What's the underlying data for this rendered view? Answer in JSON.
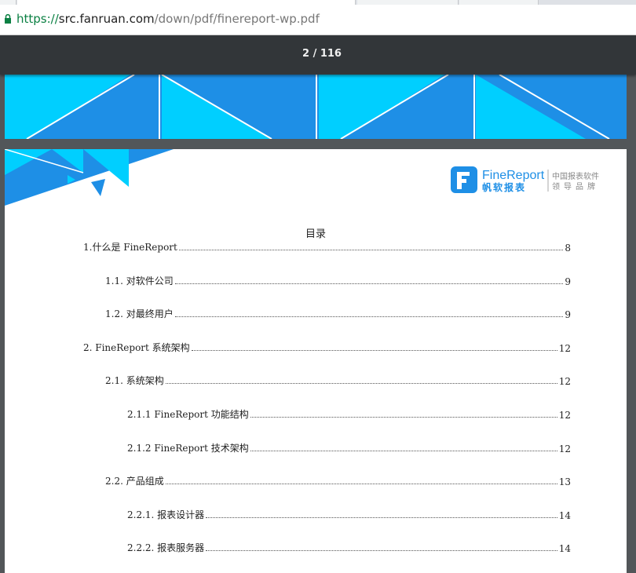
{
  "browser": {
    "url_scheme": "https://",
    "url_host": "src.fanruan.com",
    "url_path": "/down/pdf/finereport-wp.pdf"
  },
  "viewer": {
    "page_indicator": "2 / 116"
  },
  "logo": {
    "brand": "FineReport",
    "brand_cn": "帆软报表",
    "tagline_1": "中国报表软件",
    "tagline_2": "领导品牌"
  },
  "toc": {
    "title": "目录",
    "entries": [
      {
        "text": "1.什么是 FineReport",
        "page": "8"
      },
      {
        "text": "1.1. 对软件公司",
        "page": "9"
      },
      {
        "text": "1.2. 对最终用户",
        "page": "9"
      },
      {
        "text": "2. FineReport 系统架构",
        "page": "12"
      },
      {
        "text": "2.1. 系统架构",
        "page": "12"
      },
      {
        "text": "2.1.1 FineReport 功能结构",
        "page": "12"
      },
      {
        "text": "2.1.2 FineReport 技术架构",
        "page": "12"
      },
      {
        "text": "2.2. 产品组成",
        "page": "13"
      },
      {
        "text": "2.2.1. 报表设计器",
        "page": "14"
      },
      {
        "text": "2.2.2. 报表服务器",
        "page": "14"
      }
    ]
  },
  "colors": {
    "accent_blue": "#1e8fe6",
    "light_cyan": "#00cfff",
    "viewer_bar": "#323639",
    "viewer_bg": "#525659"
  }
}
